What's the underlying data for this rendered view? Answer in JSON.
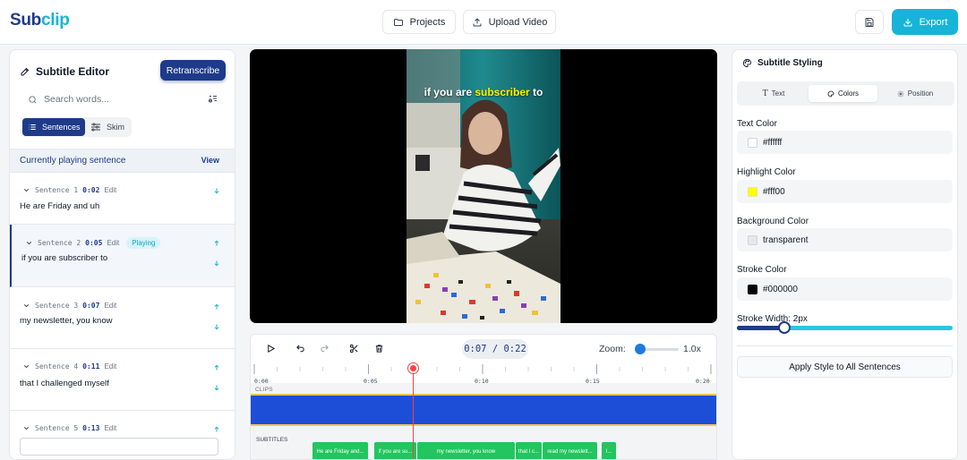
{
  "app": {
    "logo_part1": "Sub",
    "logo_part2": "clip"
  },
  "header": {
    "projects_label": "Projects",
    "upload_label": "Upload Video",
    "export_label": "Export"
  },
  "editor": {
    "title": "Subtitle Editor",
    "retranscribe_label": "Retranscribe",
    "search_placeholder": "Search words...",
    "view_modes": {
      "sentences": "Sentences",
      "skim": "Skim",
      "selected": "Sentences"
    },
    "current_label": "Currently playing sentence",
    "view_label": "View",
    "sentences": [
      {
        "label": "Sentence 1",
        "time": "0:02",
        "edit": "Edit",
        "text": "He are Friday and uh",
        "playing": false
      },
      {
        "label": "Sentence 2",
        "time": "0:05",
        "edit": "Edit",
        "text": "if you are subscriber to",
        "playing": true,
        "badge": "Playing"
      },
      {
        "label": "Sentence 3",
        "time": "0:07",
        "edit": "Edit",
        "text": "my newsletter, you know",
        "playing": false
      },
      {
        "label": "Sentence 4",
        "time": "0:11",
        "edit": "Edit",
        "text": "that I challenged myself",
        "playing": false
      },
      {
        "label": "Sentence 5",
        "time": "0:13",
        "edit": "Edit",
        "text": "",
        "playing": false
      }
    ]
  },
  "video": {
    "caption_before": "if you are ",
    "caption_highlight": "subscriber",
    "caption_after": " to"
  },
  "timeline": {
    "current_time": "0:07",
    "separator": " / ",
    "total_time": "0:22",
    "zoom_label": "Zoom:",
    "zoom_value": "1.0x",
    "zoom_level": 0.1,
    "ticks": [
      "0:00",
      "0:05",
      "0:10",
      "0:15",
      "0:20"
    ],
    "clips_label": "CLIPS",
    "subtitles_label": "SUBTITLES",
    "chips": [
      "He are Friday and...",
      "if you are su...",
      "my newsletter, you know",
      "that I c...",
      "read my newslett...",
      "I..."
    ]
  },
  "styling": {
    "title": "Subtitle Styling",
    "tabs": {
      "text": "Text",
      "colors": "Colors",
      "position": "Position",
      "active": "Colors"
    },
    "text_color_label": "Text Color",
    "text_color": "#ffffff",
    "highlight_color_label": "Highlight Color",
    "highlight_color": "#fff00",
    "highlight_swatch": "#ffff00",
    "background_color_label": "Background Color",
    "background_color": "transparent",
    "stroke_color_label": "Stroke Color",
    "stroke_color": "#000000",
    "stroke_width_label": "Stroke Width: 2px",
    "stroke_width_level": 0.22,
    "apply_label": "Apply Style to All Sentences"
  },
  "colors": {
    "brand": "#1e3a8a",
    "accent": "#16b4d8",
    "playing": "#0ea5c4",
    "clip": "#1d4ed8",
    "subtitle_chip": "#22c55e",
    "playhead": "#ef4444"
  }
}
